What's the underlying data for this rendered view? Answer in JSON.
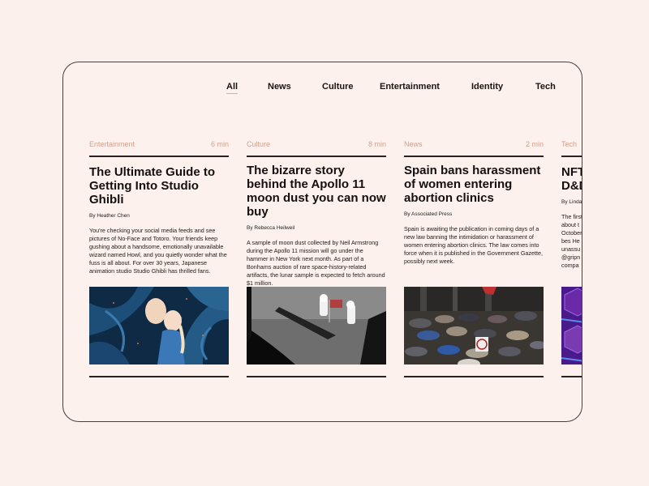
{
  "nav": {
    "items": [
      {
        "label": "All",
        "active": true
      },
      {
        "label": "News",
        "active": false
      },
      {
        "label": "Culture",
        "active": false
      },
      {
        "label": "Entertainment",
        "active": false
      },
      {
        "label": "Identity",
        "active": false
      },
      {
        "label": "Tech",
        "active": false
      }
    ]
  },
  "articles": [
    {
      "category": "Entertainment",
      "read_time": "6 min",
      "title": "The Ultimate Guide to Getting Into Studio Ghibli",
      "byline": "By Heather Chen",
      "excerpt": "You're checking your social media feeds and see pictures of No-Face and Totoro. Your friends keep gushing about a handsome, emotionally unavailable wizard named Howl, and you quietly wonder what the fuss is all about. For over 30 years, Japanese animation studio Studio Ghibli has thrilled fans.",
      "image": "anime-illustration"
    },
    {
      "category": "Culture",
      "read_time": "8 min",
      "title": "The bizarre story behind the Apollo 11 moon dust you can now buy",
      "byline": "By Rebecca Heilweil",
      "excerpt": "A sample of moon dust collected by Neil Armstrong during the Apollo 11 mission will go under the hammer in New York next month. As part of a Bonhams auction of rare space-history-related artifacts, the lunar sample is expected to fetch around $1 million.",
      "image": "moon-landing-photo"
    },
    {
      "category": "News",
      "read_time": "2 min",
      "title": "Spain bans harassment of women entering abortion clinics",
      "byline": "By Associated Press",
      "excerpt": "Spain is awaiting the publication in coming days of a new law banning the intimidation or harassment of women entering abortion clinics. The law comes into force when it is published in the Government Gazette, possibly next week.",
      "image": "umbrella-crowd-photo"
    },
    {
      "category": "Tech",
      "read_time": "",
      "title": "NFT D&D",
      "byline": "By Linda",
      "excerpt": "The first about t October the bes He got unassu @gripn compa",
      "image": "purple-cubes-graphic"
    }
  ],
  "colors": {
    "background": "#fcf0ea",
    "category": "#d4a08c",
    "nav_active_underline": "#e8a8a8",
    "rule": "#2a2222"
  }
}
